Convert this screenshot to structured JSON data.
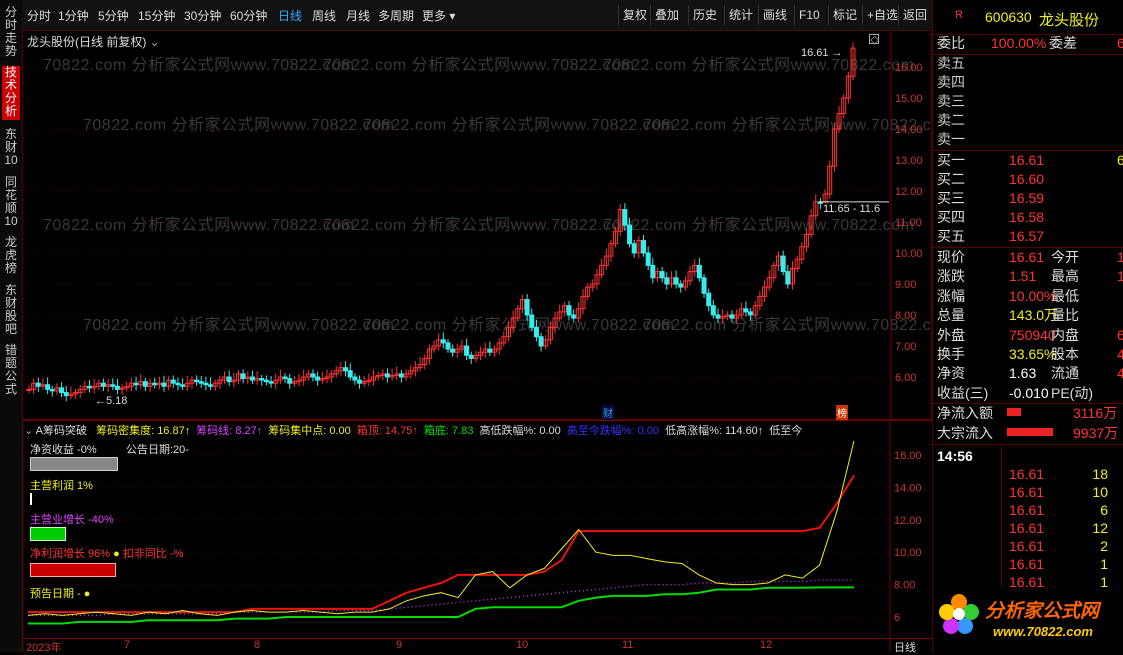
{
  "left_tabs": [
    "分时走势",
    "技术分析",
    "东财10",
    "同花顺10",
    "龙虎榜",
    "东财股吧",
    "错题公式"
  ],
  "toolbar": {
    "periods": [
      "分时",
      "1分钟",
      "5分钟",
      "15分钟",
      "30分钟",
      "60分钟",
      "日线",
      "周线",
      "月线",
      "多周期",
      "更多"
    ],
    "selected": "日线",
    "right_buttons": [
      "复权",
      "叠加",
      "历史",
      "统计",
      "画线",
      "F10",
      "标记",
      "+自选",
      "返回"
    ]
  },
  "chart": {
    "title": "龙头股份(日线 前复权)",
    "high_label": "16.61",
    "low_label": "5.18",
    "range_label": "11.65 - 11.6",
    "y_ticks": [
      "16.00",
      "15.00",
      "14.00",
      "13.00",
      "12.00",
      "11.00",
      "10.00",
      "9.00",
      "8.00",
      "7.00",
      "6.00"
    ],
    "marker_cai": "财",
    "marker_bang": "榜",
    "watermark": "70822.com 分析家公式网www.70822.com"
  },
  "indicator": {
    "header": "A筹码突破",
    "items": [
      {
        "text": "筹码密集度: 16.87↑",
        "color": "#ee2"
      },
      {
        "text": "筹码线: 8.27↑",
        "color": "#d4f"
      },
      {
        "text": "筹码集中点: 0.00",
        "color": "#ee2"
      },
      {
        "text": "箱顶: 14.75↑",
        "color": "#f33"
      },
      {
        "text": "箱底: 7.83",
        "color": "#0d0"
      },
      {
        "text": "高低跌幅%: 0.00",
        "color": "#ddd"
      },
      {
        "text": "高至今跌幅%: 0.00",
        "color": "#33f"
      },
      {
        "text": "低高涨幅%: 114.60↑",
        "color": "#ddd"
      },
      {
        "text": "低至今",
        "color": "#ddd"
      }
    ],
    "net_asset_yield": "净资收益 -0%",
    "announce_date": "公告日期:20-",
    "main_profit": "主营利润 1%",
    "main_growth": "主营业增长 -40%",
    "net_profit_growth": "净利润增长 96%",
    "deduct_yoy": "扣非同比 -%",
    "forecast_date": "预告日期 -",
    "y_ticks": [
      "16.00",
      "14.00",
      "12.00",
      "10.00",
      "8.00",
      "6"
    ],
    "x_labels": [
      "2023年",
      "7",
      "8",
      "9",
      "10",
      "11",
      "12"
    ],
    "bottom_right": "日线"
  },
  "quote": {
    "code": "600630",
    "name": "龙头股份",
    "weibi_label": "委比",
    "weibi_value": "100.00%",
    "weicha_label": "委差",
    "weicha_value": "6",
    "asks": [
      "卖五",
      "卖四",
      "卖三",
      "卖二",
      "卖一"
    ],
    "bids": [
      {
        "label": "买一",
        "price": "16.61",
        "vol": "6"
      },
      {
        "label": "买二",
        "price": "16.60",
        "vol": ""
      },
      {
        "label": "买三",
        "price": "16.59",
        "vol": ""
      },
      {
        "label": "买四",
        "price": "16.58",
        "vol": ""
      },
      {
        "label": "买五",
        "price": "16.57",
        "vol": ""
      }
    ],
    "stats": [
      {
        "l1": "现价",
        "v1": "16.61",
        "c1": "#f33",
        "l2": "今开",
        "v2": "1"
      },
      {
        "l1": "涨跌",
        "v1": "1.51",
        "c1": "#f33",
        "l2": "最高",
        "v2": "1"
      },
      {
        "l1": "涨幅",
        "v1": "10.00%",
        "c1": "#f33",
        "l2": "最低",
        "v2": ""
      },
      {
        "l1": "总量",
        "v1": "143.0万",
        "c1": "#ee2",
        "l2": "量比",
        "v2": ""
      },
      {
        "l1": "外盘",
        "v1": "750940",
        "c1": "#f33",
        "l2": "内盘",
        "v2": "67"
      },
      {
        "l1": "换手",
        "v1": "33.65%",
        "c1": "#ee2",
        "l2": "股本",
        "v2": "4."
      },
      {
        "l1": "净资",
        "v1": "1.63",
        "c1": "#fff",
        "l2": "流通",
        "v2": "4."
      },
      {
        "l1": "收益(三)",
        "v1": "-0.010",
        "c1": "#fff",
        "l2": "PE(动)",
        "v2": ""
      }
    ],
    "inflow_label": "净流入额",
    "inflow_value": "3116万",
    "block_label": "大宗流入",
    "block_value": "9937万",
    "ticks_time": "14:56",
    "ticks": [
      {
        "price": "16.61",
        "vol": "18"
      },
      {
        "price": "16.61",
        "vol": "10"
      },
      {
        "price": "16.61",
        "vol": "6"
      },
      {
        "price": "16.61",
        "vol": "12"
      },
      {
        "price": "16.61",
        "vol": "2"
      },
      {
        "price": "16.61",
        "vol": "1"
      },
      {
        "price": "16.61",
        "vol": "1"
      },
      {
        "price": "16.61",
        "vol": "12"
      }
    ],
    "logo_text": "分析家公式网",
    "logo_url": "www.70822.com"
  }
}
